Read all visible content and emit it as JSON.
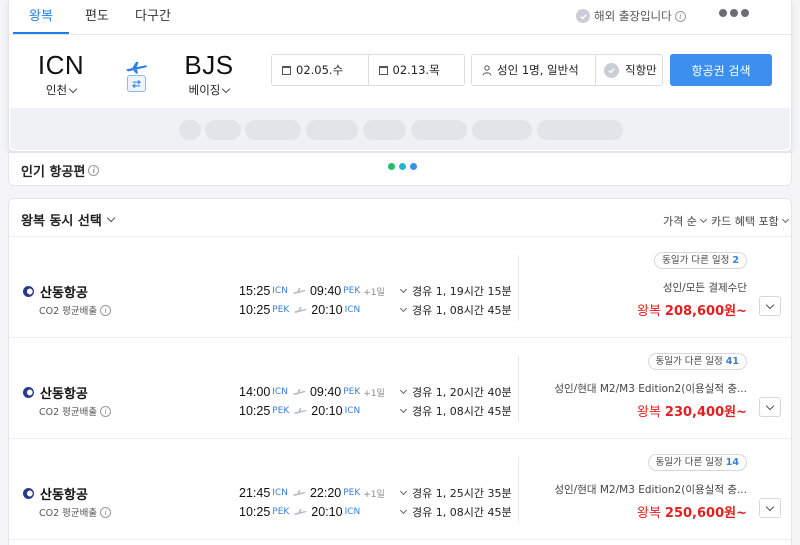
{
  "tabs": [
    "왕복",
    "편도",
    "다구간"
  ],
  "business_trip": "해외 출장입니다",
  "route": {
    "departure": {
      "code": "ICN",
      "city": "인천"
    },
    "arrival": {
      "code": "BJS",
      "city": "베이징"
    }
  },
  "dates": {
    "depart": "02.05.수",
    "return": "02.13.목"
  },
  "passengers": "성인 1명, 일반석",
  "direct_only": "직항만",
  "search_button": "항공권 검색",
  "popular": {
    "title": "인기 항공편"
  },
  "results": {
    "title": "왕복 동시 선택",
    "sort": "가격 순",
    "card_filter": "카드 혜택 포함",
    "flights": [
      {
        "airline": "산동항공",
        "co2": "CO2 평균배출",
        "outbound": {
          "dep_time": "15:25",
          "dep_ap": "ICN",
          "arr_time": "09:40",
          "arr_ap": "PEK",
          "plus": "+1일",
          "stops": "경유 1, 19시간 15분"
        },
        "inbound": {
          "dep_time": "10:25",
          "dep_ap": "PEK",
          "arr_time": "20:10",
          "arr_ap": "ICN",
          "plus": "",
          "stops": "경유 1, 08시간 45분"
        },
        "badge_label": "동일가 다른 일정",
        "badge_count": "2",
        "card": "성인/모든 결제수단",
        "price_label": "왕복",
        "price": "208,600원~"
      },
      {
        "airline": "산동항공",
        "co2": "CO2 평균배출",
        "outbound": {
          "dep_time": "14:00",
          "dep_ap": "ICN",
          "arr_time": "09:40",
          "arr_ap": "PEK",
          "plus": "+1일",
          "stops": "경유 1, 20시간 40분"
        },
        "inbound": {
          "dep_time": "10:25",
          "dep_ap": "PEK",
          "arr_time": "20:10",
          "arr_ap": "ICN",
          "plus": "",
          "stops": "경유 1, 08시간 45분"
        },
        "badge_label": "동일가 다른 일정",
        "badge_count": "41",
        "card": "성인/현대 M2/M3 Edition2(이용실적 충...",
        "price_label": "왕복",
        "price": "230,400원~"
      },
      {
        "airline": "산동항공",
        "co2": "CO2 평균배출",
        "outbound": {
          "dep_time": "21:45",
          "dep_ap": "ICN",
          "arr_time": "22:20",
          "arr_ap": "PEK",
          "plus": "+1일",
          "stops": "경유 1, 25시간 35분"
        },
        "inbound": {
          "dep_time": "10:25",
          "dep_ap": "PEK",
          "arr_time": "20:10",
          "arr_ap": "ICN",
          "plus": "",
          "stops": "경유 1, 08시간 45분"
        },
        "badge_label": "동일가 다른 일정",
        "badge_count": "14",
        "card": "성인/현대 M2/M3 Edition2(이용실적 충...",
        "price_label": "왕복",
        "price": "250,600원~"
      }
    ]
  },
  "colors": {
    "accent": "#1f7ee5",
    "button": "#3b8fef",
    "price": "#e02020",
    "loader": [
      "#1fbf6a",
      "#20b9c9",
      "#3b8fef"
    ]
  },
  "icons": [
    "check-icon",
    "info-icon",
    "more-icon",
    "plane-icon",
    "swap-icon",
    "calendar-icon",
    "person-icon",
    "chevron-down-icon",
    "airline-logo-icon"
  ]
}
